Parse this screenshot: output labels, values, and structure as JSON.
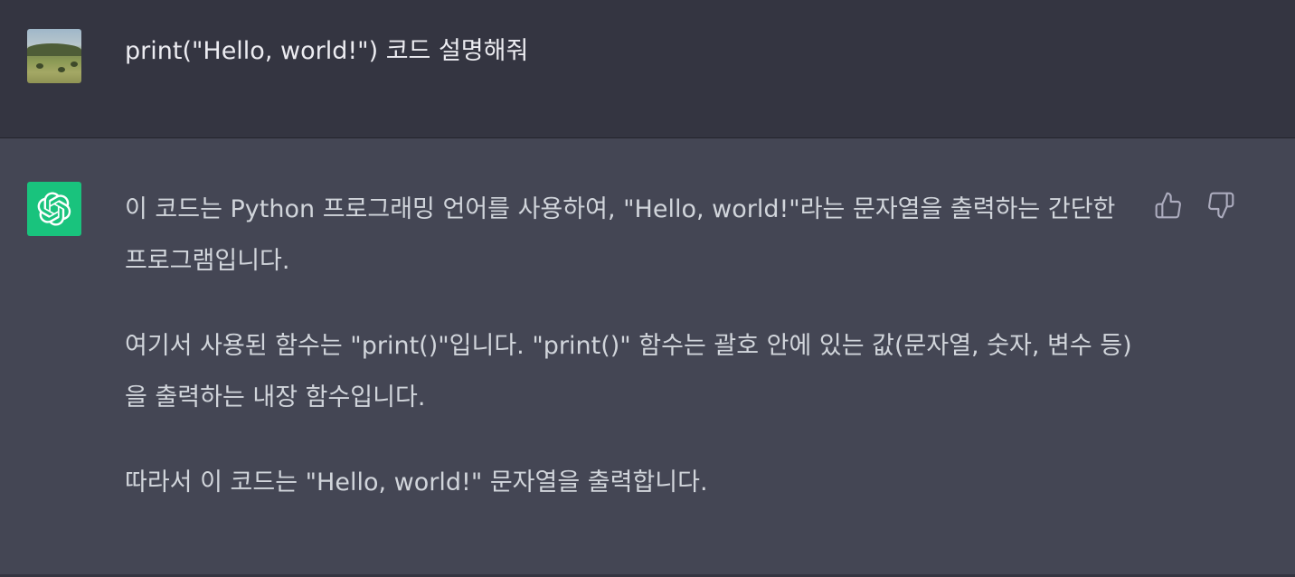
{
  "user_message": {
    "avatar": "user-landscape-avatar",
    "text": "print(\"Hello, world!\") 코드 설명해줘"
  },
  "assistant_message": {
    "avatar": "openai-logo-icon",
    "paragraphs": [
      "이 코드는 Python 프로그래밍 언어를 사용하여, \"Hello, world!\"라는 문자열을 출력하는 간단한 프로그램입니다.",
      "여기서 사용된 함수는 \"print()\"입니다. \"print()\" 함수는 괄호 안에 있는 값(문자열, 숫자, 변수 등)을 출력하는 내장 함수입니다.",
      "따라서 이 코드는 \"Hello, world!\" 문자열을 출력합니다."
    ],
    "feedback": {
      "thumbs_up_icon": "thumbs-up-icon",
      "thumbs_down_icon": "thumbs-down-icon"
    }
  },
  "colors": {
    "user_bg": "#343541",
    "assistant_bg": "#444654",
    "bot_avatar": "#19C37D",
    "text": "#ECECF1"
  }
}
